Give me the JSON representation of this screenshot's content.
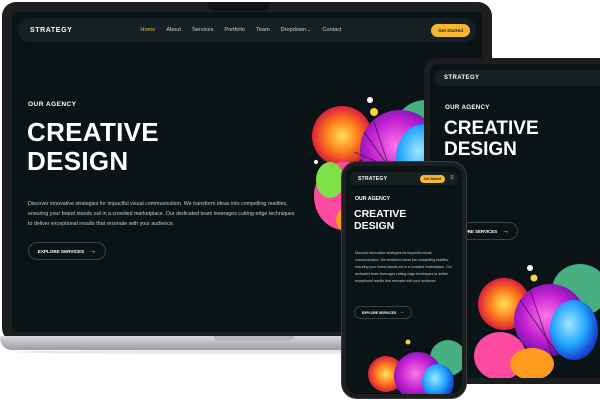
{
  "site": {
    "logo": "STRATEGY",
    "nav": [
      {
        "label": "Home",
        "active": true
      },
      {
        "label": "About"
      },
      {
        "label": "Services"
      },
      {
        "label": "Portfolio"
      },
      {
        "label": "Team"
      },
      {
        "label": "Dropdown",
        "has_submenu": true
      },
      {
        "label": "Contact"
      }
    ],
    "cta_label": "Get Started",
    "dropdown_icon": "chevron-down-icon"
  },
  "hero": {
    "eyebrow": "OUR AGENCY",
    "title_line1": "CREATIVE",
    "title_line2": "DESIGN",
    "description": "Discover innovative strategies for impactful visual communication. We transform ideas into compelling realities, ensuring your brand stands out in a crowded marketplace. Our dedicated team leverages cutting-edge techniques to deliver exceptional results that resonate with your audience.",
    "button_label": "EXPLORE SERVICES",
    "button_icon": "arrow-right-icon"
  },
  "mobile": {
    "menu_icon": "hamburger-menu-icon"
  },
  "colors": {
    "background": "#0a1416",
    "nav_background": "#152024",
    "accent": "#f5b731",
    "text": "#ffffff",
    "muted_text": "#c2cbcd"
  }
}
